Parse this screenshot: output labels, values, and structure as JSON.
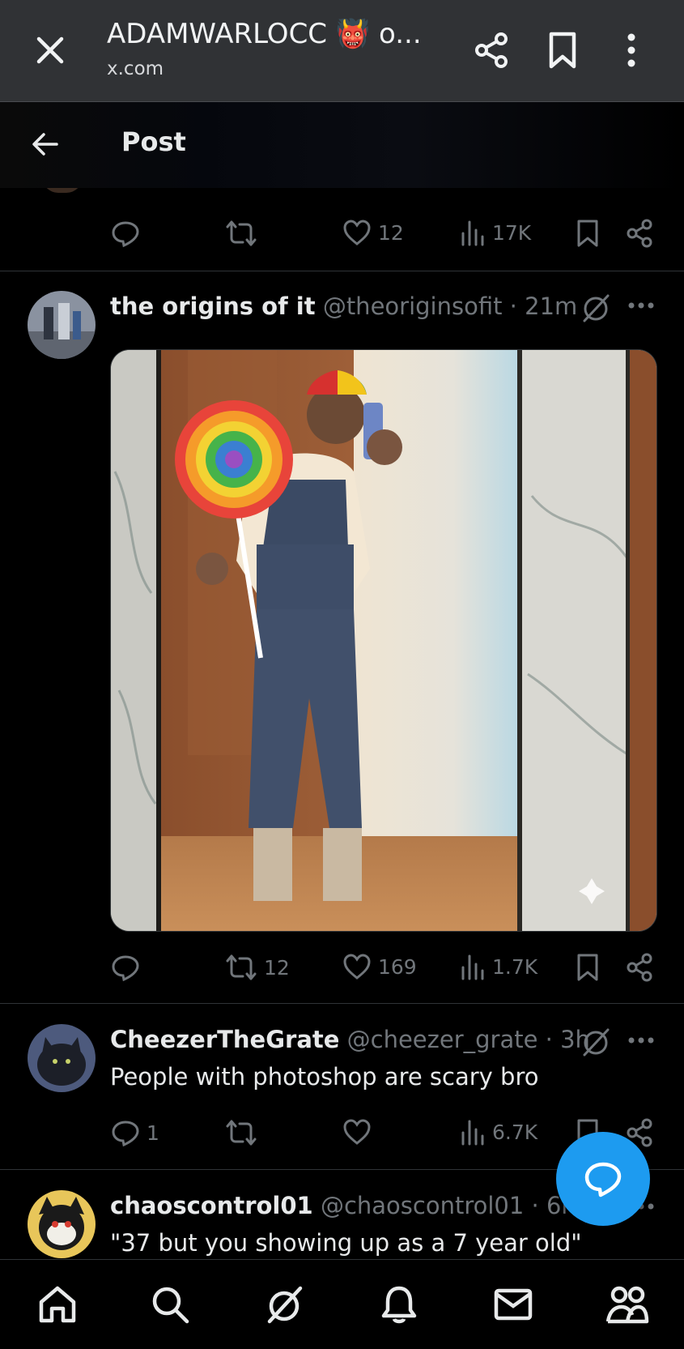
{
  "custom_tab": {
    "title": "ADAMWARLOCC 👹 o...",
    "url": "x.com"
  },
  "header": {
    "title": "Post"
  },
  "prev_post": {
    "like_count": "12",
    "view_count": "17K"
  },
  "post1": {
    "display_name": "the origins of it",
    "handle": "@theoriginsofit · 21m",
    "retweet_count": "12",
    "like_count": "169",
    "view_count": "1.7K"
  },
  "post2": {
    "display_name": "CheezerTheGrate",
    "handle": "@cheezer_grate · 3h",
    "text": "People with photoshop are scary bro",
    "reply_count": "1",
    "view_count": "6.7K"
  },
  "post3": {
    "display_name": "chaoscontrol01",
    "handle": "@chaoscontrol01 · 6h",
    "text": "\"37 but you showing up as a 7 year old\""
  },
  "colors": {
    "accent": "#1d9bf0",
    "muted": "#71767b",
    "text": "#e7e9ea"
  }
}
